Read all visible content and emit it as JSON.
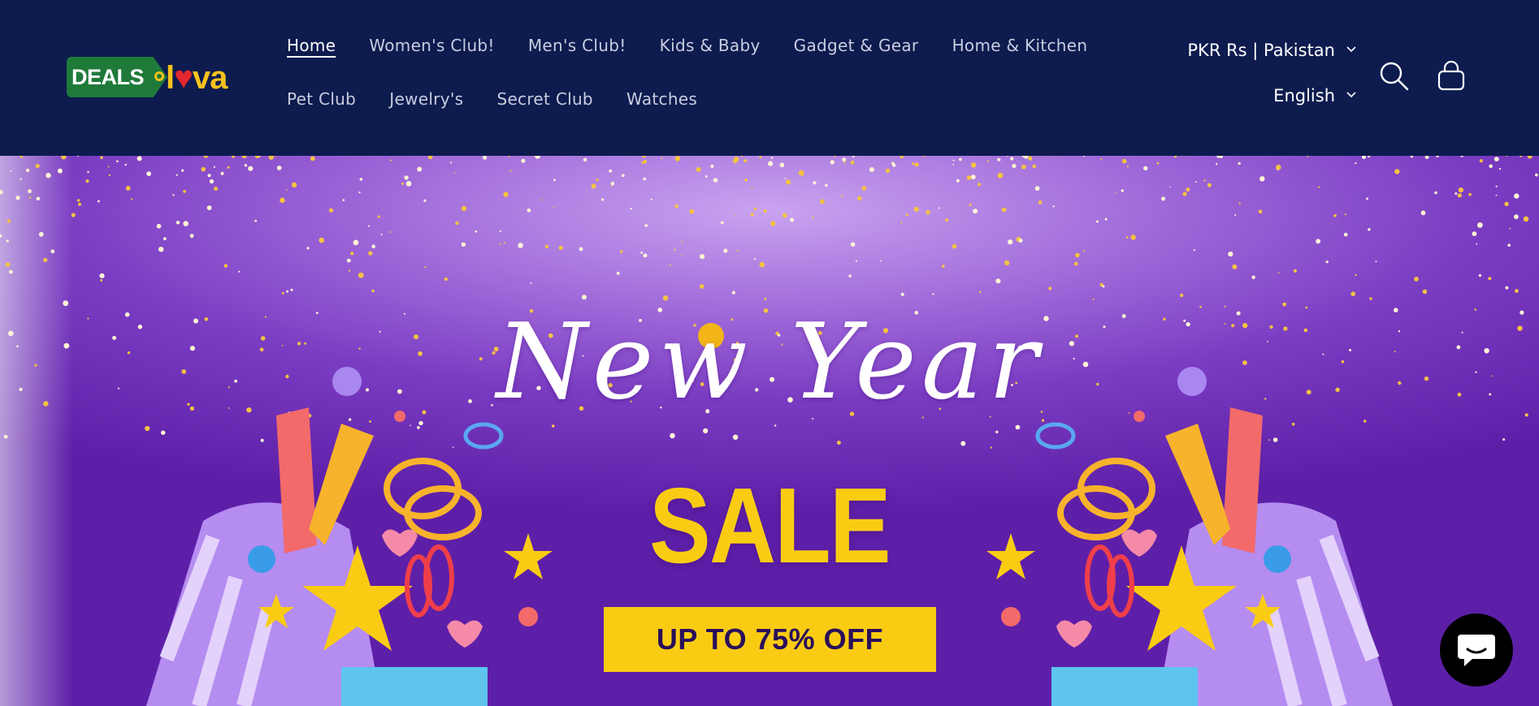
{
  "brand": {
    "logo_deals": "DEALS",
    "logo_luva_l": "l",
    "logo_luva_heart": "♥",
    "logo_luva_va": "va"
  },
  "nav": {
    "row1": [
      "Home",
      "Women's Club!",
      "Men's Club!",
      "Kids & Baby",
      "Gadget & Gear",
      "Home & Kitchen"
    ],
    "row2": [
      "Pet Club",
      "Jewelry's",
      "Secret Club",
      "Watches"
    ],
    "active": "Home"
  },
  "locale": {
    "currency": "PKR Rs | Pakistan",
    "language": "English"
  },
  "icons": {
    "search": "search-icon",
    "cart": "cart-icon",
    "chat": "chat-icon",
    "chevron": "chevron-down-icon"
  },
  "hero": {
    "script_title": "New Year",
    "sale": "SALE",
    "offer": "UP TO 75% OFF"
  },
  "colors": {
    "header_bg": "#0d1b4e",
    "accent_yellow": "#f9cc13",
    "hero_purple": "#7a3cc2",
    "logo_green": "#1f7a3a"
  }
}
